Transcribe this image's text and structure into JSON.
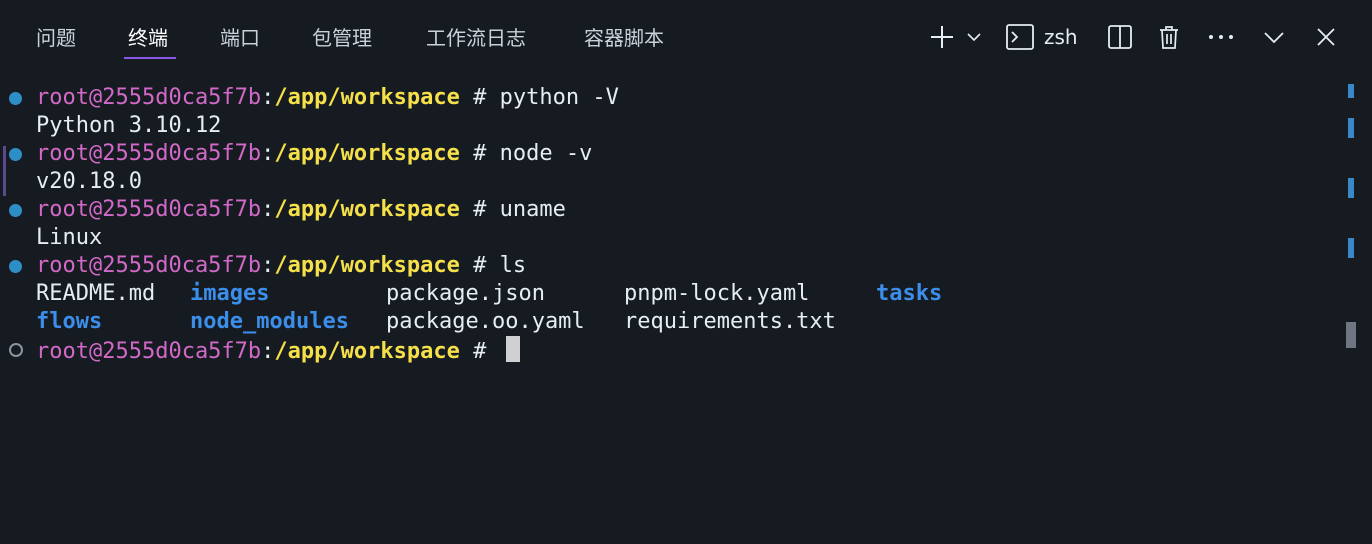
{
  "tabs": [
    {
      "label": "问题"
    },
    {
      "label": "终端",
      "active": true
    },
    {
      "label": "端口"
    },
    {
      "label": "包管理"
    },
    {
      "label": "工作流日志"
    },
    {
      "label": "容器脚本"
    }
  ],
  "toolbar": {
    "shell_name": "zsh",
    "icons": [
      "plus-icon",
      "chevron-down-icon",
      "terminal-icon",
      "split-icon",
      "trash-icon",
      "more-icon",
      "chevron-down-icon",
      "close-icon"
    ]
  },
  "prompt": {
    "user": "root@2555d0ca5f7b",
    "colon": ":",
    "path": "/app/workspace",
    "symbol": " # "
  },
  "terminal": {
    "cmd1": "python -V",
    "out1": "Python 3.10.12",
    "cmd2": "node -v",
    "out2": "v20.18.0",
    "cmd3": "uname",
    "out3": "Linux",
    "cmd4": "ls",
    "ls_row1": [
      "README.md",
      "images",
      "package.json",
      "pnpm-lock.yaml",
      "tasks"
    ],
    "ls_row2": [
      "flows",
      "node_modules",
      "package.oo.yaml",
      "requirements.txt"
    ]
  },
  "colors": {
    "background": "#161b22",
    "user": "#d269c7",
    "path": "#f5e04a",
    "directory": "#3b8eea",
    "tab_underline": "#8957e5",
    "status_dot": "#2e8fc7"
  }
}
